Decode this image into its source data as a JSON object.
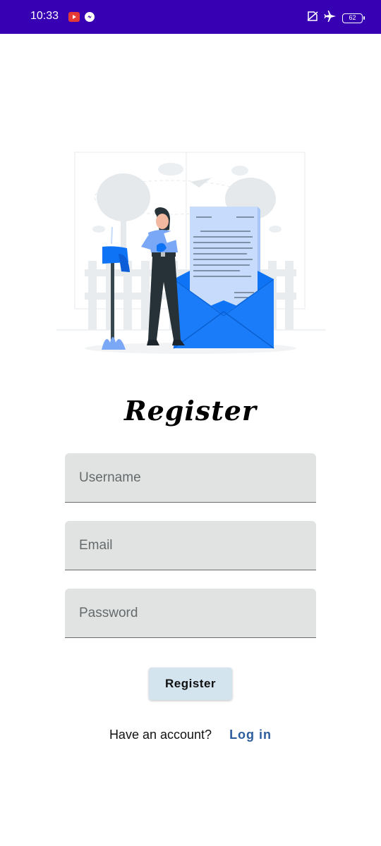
{
  "status_bar": {
    "time": "10:33",
    "battery": "62",
    "icons": [
      "video-app-icon",
      "messenger-icon",
      "no-sim-icon",
      "airplane-mode-icon",
      "battery-icon"
    ]
  },
  "illustration": {
    "name": "register-mail-illustration",
    "colors": {
      "accent": "#0f73f5",
      "light": "#c7dbfc",
      "dark": "#263238"
    }
  },
  "form": {
    "title": "Register",
    "username_placeholder": "Username",
    "email_placeholder": "Email",
    "password_placeholder": "Password",
    "submit_label": "Register"
  },
  "login": {
    "prompt": "Have an account?",
    "link_label": "Log in"
  },
  "colors": {
    "status_bar": "#3700b3",
    "field_bg": "#e1e3e3",
    "button_bg": "#d4e4ef",
    "link": "#2c5d9c"
  }
}
